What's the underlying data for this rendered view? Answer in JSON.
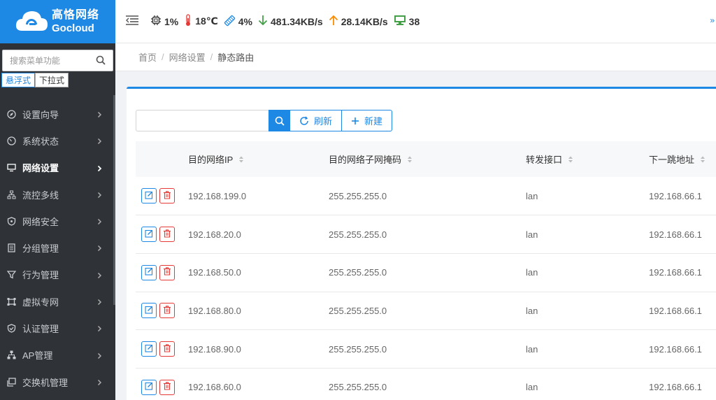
{
  "logo": {
    "name_cn": "高恪网络",
    "name_en": "Gocloud"
  },
  "sidebar": {
    "search_placeholder": "搜索菜单功能",
    "modes": [
      "悬浮式",
      "下拉式"
    ],
    "items": [
      {
        "label": "设置向导",
        "icon": "compass-icon"
      },
      {
        "label": "系统状态",
        "icon": "dashboard-icon"
      },
      {
        "label": "网络设置",
        "icon": "monitor-icon",
        "active": true
      },
      {
        "label": "流控多线",
        "icon": "flow-icon"
      },
      {
        "label": "网络安全",
        "icon": "shield-icon"
      },
      {
        "label": "分组管理",
        "icon": "group-icon"
      },
      {
        "label": "行为管理",
        "icon": "filter-icon"
      },
      {
        "label": "虚拟专网",
        "icon": "vpn-icon"
      },
      {
        "label": "认证管理",
        "icon": "shield-check-icon"
      },
      {
        "label": "AP管理",
        "icon": "sitemap-icon"
      },
      {
        "label": "交换机管理",
        "icon": "switch-icon"
      }
    ]
  },
  "topbar": {
    "cpu": "1%",
    "temperature": "18℃",
    "memory": "4%",
    "download": "481.34KB/s",
    "upload": "28.14KB/s",
    "clients": "38"
  },
  "breadcrumb": [
    "首页",
    "网络设置",
    "静态路由"
  ],
  "toolbar": {
    "search_value": "",
    "refresh_label": "刷新",
    "new_label": "新建"
  },
  "table": {
    "columns": [
      "目的网络IP",
      "目的网络子网掩码",
      "转发接口",
      "下一跳地址"
    ],
    "rows": [
      [
        "192.168.199.0",
        "255.255.255.0",
        "lan",
        "192.168.66.1"
      ],
      [
        "192.168.20.0",
        "255.255.255.0",
        "lan",
        "192.168.66.1"
      ],
      [
        "192.168.50.0",
        "255.255.255.0",
        "lan",
        "192.168.66.1"
      ],
      [
        "192.168.80.0",
        "255.255.255.0",
        "lan",
        "192.168.66.1"
      ],
      [
        "192.168.90.0",
        "255.255.255.0",
        "lan",
        "192.168.66.1"
      ],
      [
        "192.168.60.0",
        "255.255.255.0",
        "lan",
        "192.168.66.1"
      ]
    ]
  },
  "colors": {
    "accent": "#1e88e5",
    "sidebar_bg": "#2f3338",
    "danger": "#e53935",
    "download": "#43a047",
    "upload": "#fb8c00",
    "temp": "#e53935"
  }
}
